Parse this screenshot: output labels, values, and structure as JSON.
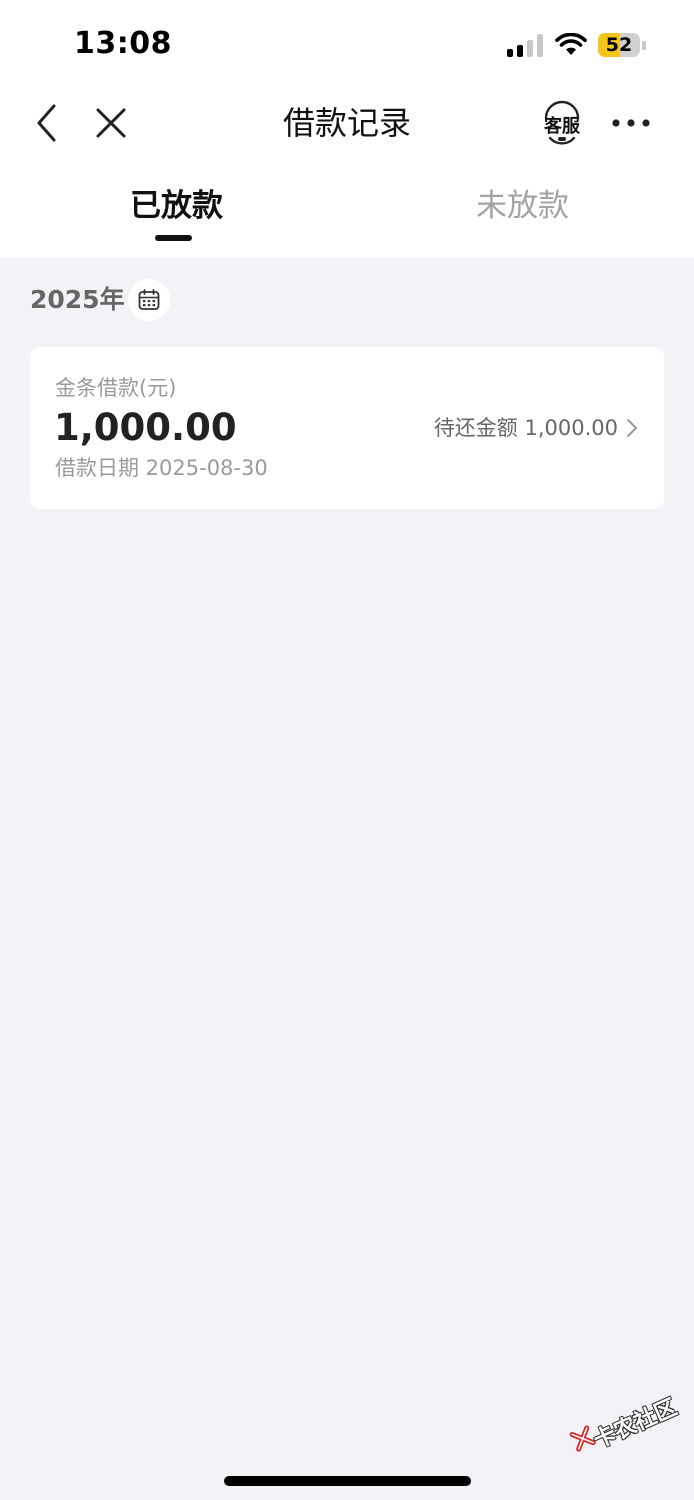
{
  "status_bar": {
    "time": "13:08",
    "battery_level": "52",
    "battery_fraction": 0.52,
    "signal_bars_active": 2,
    "signal_bars_total": 4
  },
  "nav": {
    "title": "借款记录",
    "service_label": "客服",
    "back_icon": "chevron-left-icon",
    "close_icon": "close-icon",
    "more_icon": "more-dots-icon"
  },
  "tabs": [
    {
      "label": "已放款",
      "active": true
    },
    {
      "label": "未放款",
      "active": false
    }
  ],
  "year_filter": {
    "year": "2025年",
    "icon": "calendar-icon"
  },
  "records": [
    {
      "title": "金条借款(元)",
      "amount": "1,000.00",
      "date": "借款日期 2025-08-30",
      "remaining": "待还金额 1,000.00"
    }
  ],
  "watermark": {
    "text": "卡农社区"
  },
  "colors": {
    "background": "#f2f2f7",
    "battery_accent": "#f5c518",
    "primary_text": "#111111",
    "secondary_text": "#9a9a9a"
  }
}
